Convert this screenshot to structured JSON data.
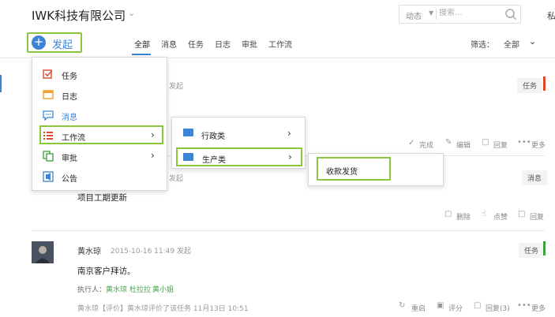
{
  "header": {
    "company": "IWK科技有限公司",
    "search_scope": "动态",
    "search_placeholder": "搜索...",
    "edge_text": "私"
  },
  "toolbar": {
    "launch_label": "发起",
    "tabs": [
      "全部",
      "消息",
      "任务",
      "日志",
      "审批",
      "工作流"
    ],
    "filter_label": "筛选：",
    "filter_value": "全部"
  },
  "menu": {
    "items": [
      {
        "label": "任务",
        "icon": "task-check-icon",
        "color": "#e0472a"
      },
      {
        "label": "日志",
        "icon": "log-icon",
        "color": "#f0a030"
      },
      {
        "label": "消息",
        "icon": "message-icon",
        "color": "#3d84d6"
      },
      {
        "label": "工作流",
        "icon": "workflow-list-icon",
        "color": "#e0472a"
      },
      {
        "label": "审批",
        "icon": "approval-icon",
        "color": "#3da03d"
      },
      {
        "label": "公告",
        "icon": "announcement-icon",
        "color": "#3d84d6"
      }
    ]
  },
  "submenu": {
    "items": [
      {
        "label": "行政类"
      },
      {
        "label": "生产类"
      }
    ]
  },
  "submenu2": {
    "items": [
      {
        "label": "收款发货"
      }
    ]
  },
  "feed": {
    "card1": {
      "meta_fragment": "发起",
      "badge": "任务",
      "badge_color": "#e0472a",
      "actions": [
        "完成",
        "编辑",
        "回复",
        "更多"
      ]
    },
    "card2": {
      "meta_fragment": "发起",
      "badge": "消息",
      "content": "项目工期更新",
      "actions": [
        "删除",
        "点赞",
        "回复"
      ]
    },
    "card3": {
      "name": "黄水琼",
      "time": "2015-10-16 11:49 发起",
      "badge": "任务",
      "badge_color": "#3da03d",
      "content": "南京客户拜访。",
      "executor_label": "执行人：",
      "executors": [
        "黄水琼",
        "杜拉拉",
        "黄小姐"
      ],
      "comment": "黄水琼【评价】黄水琼评价了该任务  11月13日 10:51",
      "actions": [
        "重启",
        "评分",
        "回复(3)",
        "更多"
      ]
    }
  }
}
